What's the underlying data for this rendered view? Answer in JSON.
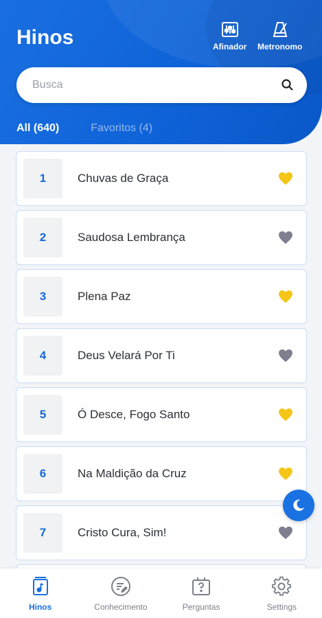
{
  "header": {
    "title": "Hinos",
    "tools": [
      {
        "label": "Afinador",
        "icon": "tuner-icon"
      },
      {
        "label": "Metronomo",
        "icon": "metronome-icon"
      }
    ]
  },
  "search": {
    "placeholder": "Busca",
    "icon": "search-icon"
  },
  "tabs": [
    {
      "label": "All (640)",
      "active": true
    },
    {
      "label": "Favoritos (4)",
      "active": false
    }
  ],
  "hymns": [
    {
      "number": "1",
      "title": "Chuvas de Graça",
      "favorite": true
    },
    {
      "number": "2",
      "title": "Saudosa Lembrança",
      "favorite": false
    },
    {
      "number": "3",
      "title": "Plena Paz",
      "favorite": true
    },
    {
      "number": "4",
      "title": "Deus Velará Por Ti",
      "favorite": false
    },
    {
      "number": "5",
      "title": "Ó Desce, Fogo Santo",
      "favorite": true
    },
    {
      "number": "6",
      "title": "Na Maldição da Cruz",
      "favorite": true
    },
    {
      "number": "7",
      "title": "Cristo Cura, Sim!",
      "favorite": false
    }
  ],
  "colors": {
    "accent": "#1a6fe0",
    "favorite": "#f5c518",
    "not_favorite": "#7d7f8e"
  },
  "fab": {
    "icon": "moon-icon"
  },
  "bottom_nav": [
    {
      "label": "Hinos",
      "icon": "music-book-icon",
      "active": true
    },
    {
      "label": "Conhecimento",
      "icon": "notes-icon",
      "active": false
    },
    {
      "label": "Perguntas",
      "icon": "question-board-icon",
      "active": false
    },
    {
      "label": "Settings",
      "icon": "gear-icon",
      "active": false
    }
  ]
}
